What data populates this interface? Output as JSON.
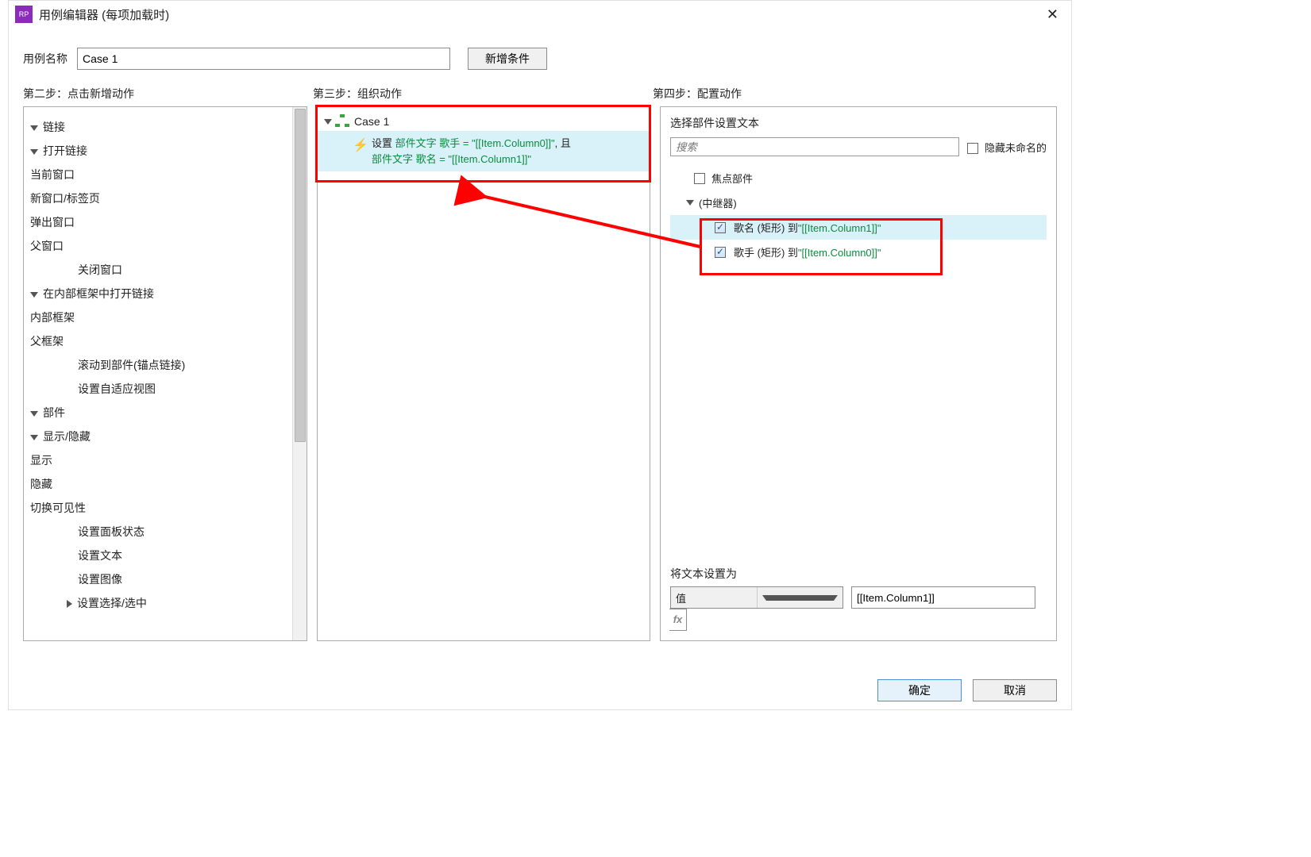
{
  "titlebar": {
    "title": "用例编辑器 (每项加载时)"
  },
  "caseName": {
    "label": "用例名称",
    "value": "Case 1"
  },
  "addCondition": "新增条件",
  "steps": {
    "s2": "第二步：点击新增动作",
    "s3": "第三步：组织动作",
    "s4": "第四步：配置动作"
  },
  "leftTree": {
    "links": "链接",
    "openLink": "打开链接",
    "currentWindow": "当前窗口",
    "newWindowTab": "新窗口/标签页",
    "popupWindow": "弹出窗口",
    "parentWindow": "父窗口",
    "closeWindow": "关闭窗口",
    "openInFrame": "在内部框架中打开链接",
    "innerFrame": "内部框架",
    "parentFrame": "父框架",
    "scrollToWidget": "滚动到部件(锚点链接)",
    "setAdaptive": "设置自适应视图",
    "widgets": "部件",
    "showHide": "显示/隐藏",
    "show": "显示",
    "hide": "隐藏",
    "toggleVis": "切换可见性",
    "setPanelState": "设置面板状态",
    "setText": "设置文本",
    "setImage": "设置图像",
    "setSelected": "设置选择/选中"
  },
  "mid": {
    "caseLabel": "Case 1",
    "action_prefix": "设置 ",
    "action_green1": "部件文字 歌手 = \"[[Item.Column0]]\"",
    "action_and": ", 且 ",
    "action_green2": "部件文字 歌名 = \"[[Item.Column1]]\""
  },
  "right": {
    "heading": "选择部件设置文本",
    "searchPlaceholder": "搜索",
    "hideUnnamed": "隐藏未命名的",
    "focusWidget": "焦点部件",
    "repeater": "(中继器)",
    "item1_pre": "歌名 (矩形) 到",
    "item1_val": "\"[[Item.Column1]]\"",
    "item2_pre": "歌手 (矩形) 到",
    "item2_val": "\"[[Item.Column0]]\"",
    "setTextTo": "将文本设置为",
    "valueLabel": "值",
    "valueInput": "[[Item.Column1]]"
  },
  "footer": {
    "ok": "确定",
    "cancel": "取消"
  }
}
